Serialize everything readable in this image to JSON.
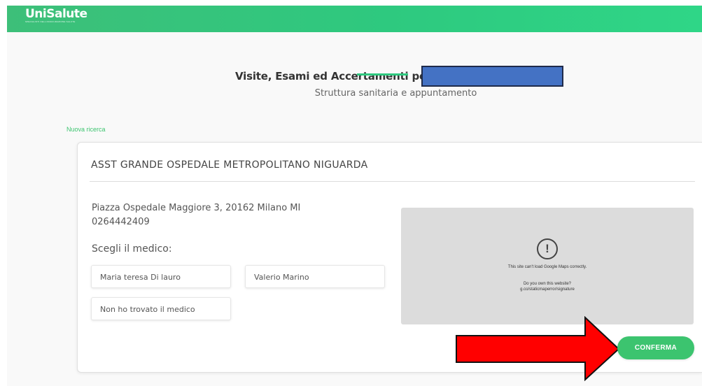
{
  "header": {
    "logo_name": "UniSalute",
    "logo_tagline": "SPECIALISTI NELL'ASSICURAZIONE SALUTE"
  },
  "page": {
    "title": "Visite, Esami ed Accertamenti per",
    "subtitle": "Struttura sanitaria e appuntamento",
    "new_search": "Nuova ricerca"
  },
  "structure": {
    "name": "ASST GRANDE OSPEDALE METROPOLITANO NIGUARDA",
    "address": "Piazza Ospedale Maggiore 3, 20162 Milano MI",
    "phone": "0264442409",
    "choose_label": "Scegli il medico:",
    "doctors": [
      "Maria teresa Di lauro",
      "Valerio Marino",
      "Non ho trovato il medico"
    ]
  },
  "map": {
    "error": "This site can't load Google Maps correctly.",
    "question": "Do you own this website?",
    "link": "g.co/staticmaperror/signature"
  },
  "actions": {
    "confirm": "CONFERMA"
  },
  "colors": {
    "brand_green": "#3cc46f",
    "redaction_blue": "#4472c4",
    "arrow_red": "#ff0000"
  }
}
